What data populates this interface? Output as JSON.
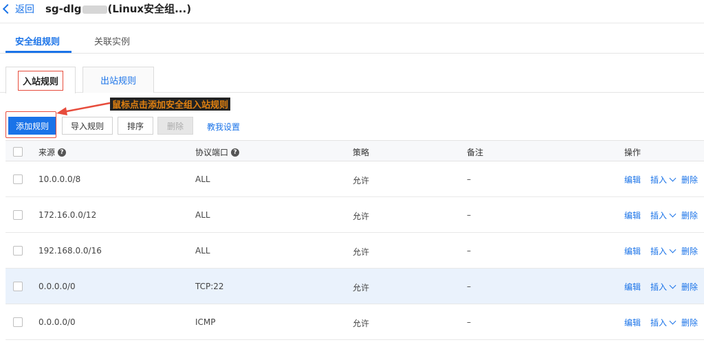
{
  "header": {
    "back_label": "返回",
    "title_prefix": "sg-dlg",
    "title_suffix": "(Linux安全组...)"
  },
  "tabs": [
    {
      "label": "安全组规则",
      "active": true
    },
    {
      "label": "关联实例",
      "active": false
    }
  ],
  "subtabs": [
    {
      "label": "入站规则",
      "active": true
    },
    {
      "label": "出站规则",
      "active": false
    }
  ],
  "toolbar": {
    "add_label": "添加规则",
    "import_label": "导入规则",
    "sort_label": "排序",
    "delete_label": "删除",
    "guide_label": "教我设置"
  },
  "annotation": {
    "text": "鼠标点击添加安全组入站规则",
    "color": "#e74c3c"
  },
  "table": {
    "columns": {
      "source": "来源",
      "port": "协议端口",
      "policy": "策略",
      "note": "备注",
      "action": "操作"
    },
    "rows": [
      {
        "source": "10.0.0.0/8",
        "port": "ALL",
        "policy": "允许",
        "note": "–"
      },
      {
        "source": "172.16.0.0/12",
        "port": "ALL",
        "policy": "允许",
        "note": "–"
      },
      {
        "source": "192.168.0.0/16",
        "port": "ALL",
        "policy": "允许",
        "note": "–"
      },
      {
        "source": "0.0.0.0/0",
        "port": "TCP:22",
        "policy": "允许",
        "note": "–",
        "highlighted": true
      },
      {
        "source": "0.0.0.0/0",
        "port": "ICMP",
        "policy": "允许",
        "note": "–"
      }
    ],
    "actions": {
      "edit": "编辑",
      "insert": "插入",
      "delete": "删除"
    }
  },
  "colors": {
    "accent": "#1a73e8",
    "highlight_row": "#eaf2fc",
    "annotation_text": "#e08010"
  }
}
